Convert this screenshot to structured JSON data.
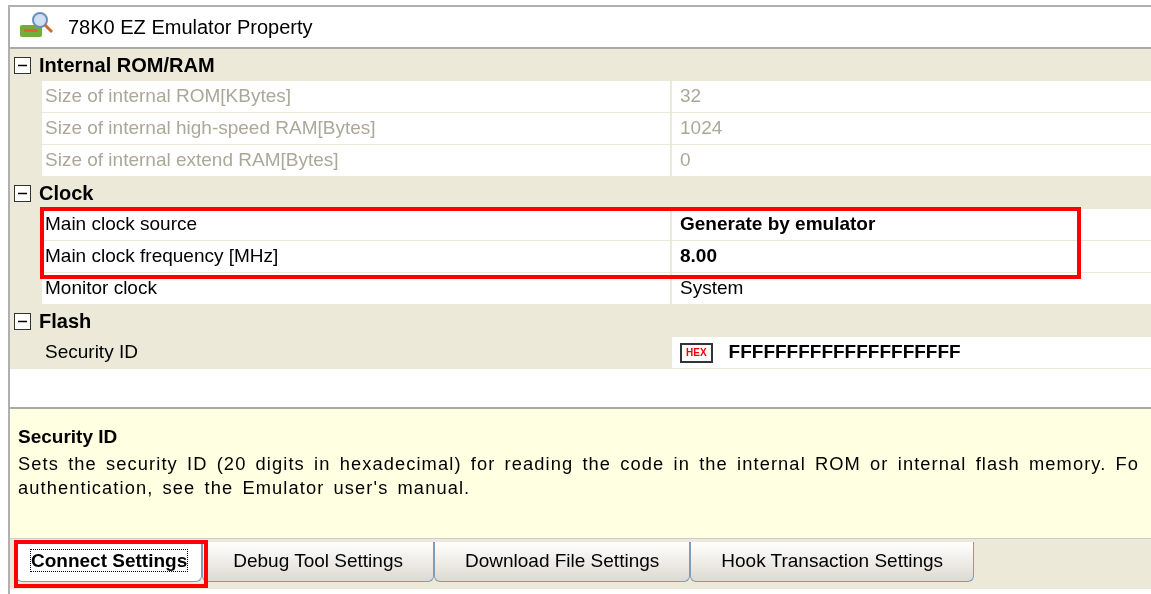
{
  "window": {
    "title": "78K0 EZ Emulator Property"
  },
  "categories": [
    {
      "label": "Internal ROM/RAM",
      "expanded": true,
      "properties": [
        {
          "name": "Size of internal ROM[KBytes]",
          "value": "32",
          "disabled": true,
          "changed": false,
          "highlighted": false,
          "kind": "text"
        },
        {
          "name": "Size of internal high-speed RAM[Bytes]",
          "value": "1024",
          "disabled": true,
          "changed": false,
          "highlighted": false,
          "kind": "text"
        },
        {
          "name": "Size of internal extend RAM[Bytes]",
          "value": "0",
          "disabled": true,
          "changed": false,
          "highlighted": false,
          "kind": "text"
        }
      ]
    },
    {
      "label": "Clock",
      "expanded": true,
      "properties": [
        {
          "name": "Main clock source",
          "value": "Generate by emulator",
          "disabled": false,
          "changed": true,
          "highlighted": true,
          "kind": "text"
        },
        {
          "name": "Main clock frequency [MHz]",
          "value": "8.00",
          "disabled": false,
          "changed": true,
          "highlighted": true,
          "kind": "text"
        },
        {
          "name": "Monitor clock",
          "value": "System",
          "disabled": false,
          "changed": false,
          "highlighted": false,
          "kind": "text"
        }
      ]
    },
    {
      "label": "Flash",
      "expanded": true,
      "properties": [
        {
          "name": "Security ID",
          "value": "FFFFFFFFFFFFFFFFFFFF",
          "disabled": false,
          "changed": true,
          "highlighted": false,
          "kind": "hex",
          "badge": "HEX",
          "selected": true
        }
      ]
    }
  ],
  "description": {
    "title": "Security ID",
    "lines": [
      "Sets the security ID (20 digits in hexadecimal) for reading the code in the internal ROM or internal flash memory. Fo",
      "authentication, see the Emulator user's manual."
    ]
  },
  "tabs": [
    {
      "label": "Connect Settings",
      "selected": true,
      "highlighted": true
    },
    {
      "label": "Debug Tool Settings",
      "selected": false,
      "highlighted": false
    },
    {
      "label": "Download File Settings",
      "selected": false,
      "highlighted": false
    },
    {
      "label": "Hook Transaction Settings",
      "selected": false,
      "highlighted": false
    }
  ]
}
